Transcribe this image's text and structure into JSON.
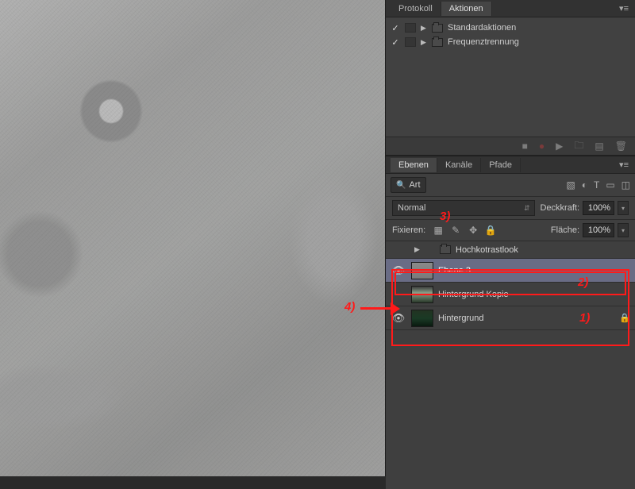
{
  "actions_panel": {
    "tabs": {
      "protocol": "Protokoll",
      "actions": "Aktionen"
    },
    "rows": [
      {
        "label": "Standardaktionen"
      },
      {
        "label": "Frequenztrennung"
      }
    ],
    "active_tab": "Aktionen"
  },
  "layers_panel": {
    "tabs": {
      "layers": "Ebenen",
      "channels": "Kanäle",
      "paths": "Pfade"
    },
    "active_tab": "Ebenen",
    "type_filter": "Art",
    "filter_icons": [
      "image-icon",
      "adjustment-icon",
      "type-icon",
      "shape-icon",
      "smartobject-icon"
    ],
    "blend_mode": "Normal",
    "opacity_label": "Deckkraft:",
    "opacity_value": "100%",
    "lock_label": "Fixieren:",
    "fill_label": "Fläche:",
    "fill_value": "100%",
    "group_name": "Hochkotrastlook",
    "layers": [
      {
        "name": "Ebene 3",
        "visible": true,
        "selected": true,
        "thumb": "grey",
        "locked": false
      },
      {
        "name": "Hintergrund Kopie",
        "visible": false,
        "selected": false,
        "thumb": "portrait1",
        "locked": false
      },
      {
        "name": "Hintergrund",
        "visible": true,
        "selected": false,
        "thumb": "portrait2",
        "locked": true
      }
    ]
  },
  "annotations": {
    "a1": "1)",
    "a2": "2)",
    "a3": "3)",
    "a4": "4)"
  },
  "colors": {
    "annotation": "#ff1a1a",
    "panel_bg": "#3b3b3b",
    "selected_layer": "#696c85"
  }
}
